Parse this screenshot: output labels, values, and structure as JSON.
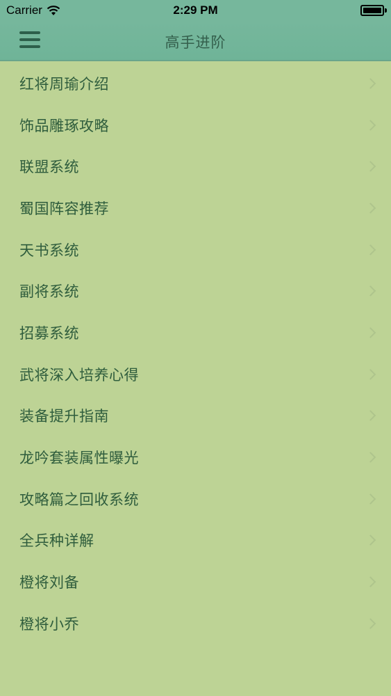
{
  "status_bar": {
    "carrier": "Carrier",
    "time": "2:29 PM",
    "icons": [
      "wifi-icon",
      "battery-icon"
    ]
  },
  "nav": {
    "title": "高手进阶",
    "menu_icon": "hamburger-menu-icon"
  },
  "list": {
    "items": [
      {
        "label": "红将周瑜介绍"
      },
      {
        "label": "饰品雕琢攻略"
      },
      {
        "label": "联盟系统"
      },
      {
        "label": "蜀国阵容推荐"
      },
      {
        "label": "天书系统"
      },
      {
        "label": "副将系统"
      },
      {
        "label": "招募系统"
      },
      {
        "label": "武将深入培养心得"
      },
      {
        "label": "装备提升指南"
      },
      {
        "label": "龙吟套装属性曝光"
      },
      {
        "label": "攻略篇之回收系统"
      },
      {
        "label": "全兵种详解"
      },
      {
        "label": "橙将刘备"
      },
      {
        "label": "橙将小乔"
      }
    ],
    "chevron_icon": "chevron-right-icon"
  },
  "colors": {
    "background": "#bdd395",
    "nav_bar": "#76b79c",
    "text": "#2f5d3d"
  }
}
